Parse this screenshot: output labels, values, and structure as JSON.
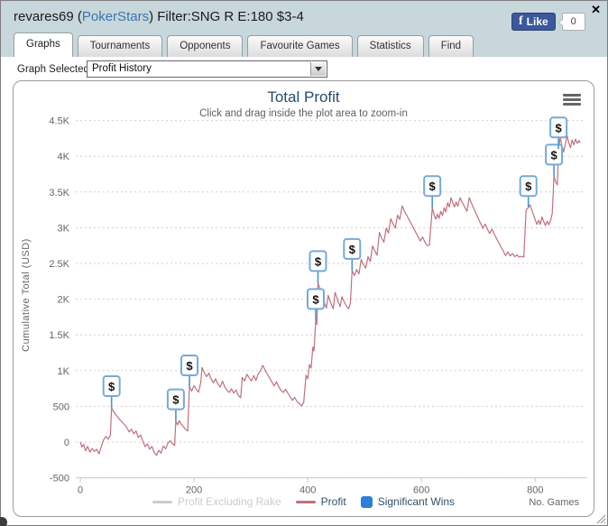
{
  "colors": {
    "header_bg": "#c7d7db",
    "fb_blue": "#3b579d",
    "link_blue": "#3a75b0",
    "title_navy": "#274b6d",
    "line_red": "#c0707a",
    "marker_blue": "#74aadb"
  },
  "header": {
    "title_prefix": "revares69 (",
    "site_link": "PokerStars",
    "title_suffix": ") Filter:SNG R E:180 $3-4",
    "fb_like_label": "Like",
    "fb_icon": "f",
    "fb_count": "0",
    "close_label": "✕"
  },
  "tabs": [
    {
      "label": "Graphs",
      "active": true
    },
    {
      "label": "Tournaments",
      "active": false
    },
    {
      "label": "Opponents",
      "active": false
    },
    {
      "label": "Favourite Games",
      "active": false
    },
    {
      "label": "Statistics",
      "active": false
    },
    {
      "label": "Find",
      "active": false
    }
  ],
  "graph_selector": {
    "label": "Graph Selected:",
    "value": "Profit History"
  },
  "chart_data": {
    "type": "line",
    "title": "Total Profit",
    "subtitle": "Click and drag inside the plot area to zoom-in",
    "ylabel": "Cumulative Total (USD)",
    "xlabel": "No. Games",
    "xlim": [
      0,
      890
    ],
    "ylim": [
      -500,
      4500
    ],
    "grid": "horizontal dotted",
    "legend_position": "bottom center",
    "xticks": [
      {
        "v": 0,
        "label": "0"
      },
      {
        "v": 200,
        "label": "200"
      },
      {
        "v": 400,
        "label": "400"
      },
      {
        "v": 600,
        "label": "600"
      },
      {
        "v": 800,
        "label": "800"
      }
    ],
    "yticks": [
      {
        "v": -500,
        "label": "-500"
      },
      {
        "v": 0,
        "label": "0"
      },
      {
        "v": 500,
        "label": "500"
      },
      {
        "v": 1000,
        "label": "1K"
      },
      {
        "v": 1500,
        "label": "1.5K"
      },
      {
        "v": 2000,
        "label": "2K"
      },
      {
        "v": 2500,
        "label": "2.5K"
      },
      {
        "v": 3000,
        "label": "3K"
      },
      {
        "v": 3500,
        "label": "3.5K"
      },
      {
        "v": 4000,
        "label": "4K"
      },
      {
        "v": 4500,
        "label": "4.5K"
      }
    ],
    "legend": [
      {
        "name": "Profit Excluding Rake",
        "color": "#cccccc",
        "symbol": "line",
        "enabled": false
      },
      {
        "name": "Profit",
        "color": "#c0707a",
        "symbol": "line",
        "enabled": true
      },
      {
        "name": "Significant Wins",
        "color": "#2f7ed8",
        "symbol": "square",
        "enabled": true
      }
    ],
    "series": [
      {
        "name": "Profit",
        "color": "#c0707a",
        "points": [
          [
            0,
            0
          ],
          [
            3,
            -70
          ],
          [
            6,
            -30
          ],
          [
            9,
            -120
          ],
          [
            13,
            -60
          ],
          [
            17,
            -140
          ],
          [
            21,
            -90
          ],
          [
            25,
            -130
          ],
          [
            29,
            -100
          ],
          [
            33,
            -165
          ],
          [
            37,
            -60
          ],
          [
            41,
            30
          ],
          [
            45,
            80
          ],
          [
            49,
            40
          ],
          [
            53,
            95
          ],
          [
            55,
            480
          ],
          [
            59,
            420
          ],
          [
            64,
            370
          ],
          [
            69,
            320
          ],
          [
            75,
            265
          ],
          [
            81,
            215
          ],
          [
            86,
            140
          ],
          [
            90,
            180
          ],
          [
            94,
            115
          ],
          [
            98,
            155
          ],
          [
            102,
            65
          ],
          [
            106,
            100
          ],
          [
            110,
            15
          ],
          [
            114,
            -65
          ],
          [
            118,
            -25
          ],
          [
            122,
            -100
          ],
          [
            126,
            -60
          ],
          [
            130,
            -145
          ],
          [
            134,
            -185
          ],
          [
            138,
            -115
          ],
          [
            142,
            -155
          ],
          [
            146,
            -55
          ],
          [
            150,
            -95
          ],
          [
            154,
            -15
          ],
          [
            158,
            20
          ],
          [
            162,
            -20
          ],
          [
            166,
            -45
          ],
          [
            168,
            295
          ],
          [
            171,
            240
          ],
          [
            174,
            300
          ],
          [
            177,
            255
          ],
          [
            181,
            220
          ],
          [
            185,
            180
          ],
          [
            189,
            155
          ],
          [
            192,
            770
          ],
          [
            196,
            715
          ],
          [
            200,
            790
          ],
          [
            204,
            740
          ],
          [
            208,
            700
          ],
          [
            212,
            835
          ],
          [
            214,
            1045
          ],
          [
            218,
            975
          ],
          [
            222,
            915
          ],
          [
            226,
            965
          ],
          [
            230,
            885
          ],
          [
            234,
            830
          ],
          [
            238,
            885
          ],
          [
            242,
            815
          ],
          [
            246,
            770
          ],
          [
            250,
            855
          ],
          [
            254,
            775
          ],
          [
            258,
            725
          ],
          [
            262,
            695
          ],
          [
            266,
            745
          ],
          [
            270,
            685
          ],
          [
            274,
            730
          ],
          [
            278,
            650
          ],
          [
            282,
            620
          ],
          [
            285,
            905
          ],
          [
            289,
            855
          ],
          [
            293,
            950
          ],
          [
            297,
            900
          ],
          [
            301,
            855
          ],
          [
            305,
            930
          ],
          [
            309,
            865
          ],
          [
            313,
            955
          ],
          [
            317,
            1000
          ],
          [
            321,
            1075
          ],
          [
            325,
            1005
          ],
          [
            329,
            950
          ],
          [
            333,
            895
          ],
          [
            337,
            840
          ],
          [
            341,
            785
          ],
          [
            345,
            845
          ],
          [
            349,
            775
          ],
          [
            353,
            725
          ],
          [
            357,
            695
          ],
          [
            361,
            740
          ],
          [
            365,
            685
          ],
          [
            369,
            635
          ],
          [
            373,
            585
          ],
          [
            377,
            625
          ],
          [
            381,
            570
          ],
          [
            385,
            540
          ],
          [
            389,
            505
          ],
          [
            393,
            555
          ],
          [
            397,
            935
          ],
          [
            400,
            885
          ],
          [
            403,
            1085
          ],
          [
            406,
            1035
          ],
          [
            409,
            1330
          ],
          [
            411,
            1275
          ],
          [
            414,
            1700
          ],
          [
            416,
            1645
          ],
          [
            418,
            2230
          ],
          [
            421,
            2155
          ],
          [
            424,
            2075
          ],
          [
            427,
            1995
          ],
          [
            430,
            1935
          ],
          [
            433,
            1875
          ],
          [
            436,
            2055
          ],
          [
            439,
            1985
          ],
          [
            442,
            1915
          ],
          [
            445,
            1865
          ],
          [
            448,
            2095
          ],
          [
            451,
            2025
          ],
          [
            454,
            1955
          ],
          [
            457,
            1895
          ],
          [
            460,
            2035
          ],
          [
            464,
            1965
          ],
          [
            468,
            1905
          ],
          [
            472,
            1865
          ],
          [
            475,
            1945
          ],
          [
            478,
            2400
          ],
          [
            482,
            2330
          ],
          [
            486,
            2415
          ],
          [
            490,
            2355
          ],
          [
            494,
            2555
          ],
          [
            498,
            2485
          ],
          [
            502,
            2435
          ],
          [
            506,
            2595
          ],
          [
            510,
            2525
          ],
          [
            514,
            2745
          ],
          [
            518,
            2675
          ],
          [
            522,
            2615
          ],
          [
            526,
            2935
          ],
          [
            530,
            2855
          ],
          [
            534,
            2795
          ],
          [
            538,
            2995
          ],
          [
            542,
            2925
          ],
          [
            546,
            3125
          ],
          [
            550,
            3055
          ],
          [
            554,
            2995
          ],
          [
            558,
            3175
          ],
          [
            562,
            3115
          ],
          [
            566,
            3305
          ],
          [
            570,
            3235
          ],
          [
            574,
            3175
          ],
          [
            578,
            3115
          ],
          [
            582,
            3055
          ],
          [
            586,
            2995
          ],
          [
            590,
            2935
          ],
          [
            594,
            2875
          ],
          [
            598,
            2815
          ],
          [
            602,
            2870
          ],
          [
            606,
            2800
          ],
          [
            610,
            2750
          ],
          [
            614,
            2755
          ],
          [
            619,
            3280
          ],
          [
            622,
            3180
          ],
          [
            625,
            3120
          ],
          [
            628,
            3190
          ],
          [
            631,
            3130
          ],
          [
            634,
            3230
          ],
          [
            637,
            3170
          ],
          [
            640,
            3280
          ],
          [
            643,
            3220
          ],
          [
            646,
            3350
          ],
          [
            649,
            3290
          ],
          [
            652,
            3420
          ],
          [
            655,
            3350
          ],
          [
            658,
            3290
          ],
          [
            661,
            3360
          ],
          [
            664,
            3300
          ],
          [
            668,
            3420
          ],
          [
            672,
            3350
          ],
          [
            676,
            3290
          ],
          [
            680,
            3230
          ],
          [
            684,
            3420
          ],
          [
            688,
            3340
          ],
          [
            692,
            3270
          ],
          [
            696,
            3200
          ],
          [
            700,
            3130
          ],
          [
            704,
            3060
          ],
          [
            708,
            2990
          ],
          [
            712,
            3050
          ],
          [
            716,
            2980
          ],
          [
            720,
            2920
          ],
          [
            724,
            2980
          ],
          [
            728,
            2910
          ],
          [
            732,
            2850
          ],
          [
            736,
            2790
          ],
          [
            740,
            2730
          ],
          [
            744,
            2670
          ],
          [
            748,
            2610
          ],
          [
            752,
            2660
          ],
          [
            756,
            2605
          ],
          [
            760,
            2640
          ],
          [
            764,
            2595
          ],
          [
            768,
            2620
          ],
          [
            772,
            2590
          ],
          [
            776,
            2600
          ],
          [
            780,
            2590
          ],
          [
            784,
            3250
          ],
          [
            788,
            3280
          ],
          [
            791,
            3320
          ],
          [
            794,
            3250
          ],
          [
            797,
            3180
          ],
          [
            800,
            3110
          ],
          [
            803,
            3045
          ],
          [
            806,
            3105
          ],
          [
            809,
            3045
          ],
          [
            812,
            3150
          ],
          [
            815,
            3090
          ],
          [
            818,
            3030
          ],
          [
            821,
            3090
          ],
          [
            824,
            3040
          ],
          [
            827,
            3100
          ],
          [
            830,
            3200
          ],
          [
            833,
            3720
          ],
          [
            836,
            3640
          ],
          [
            839,
            3600
          ],
          [
            841,
            4100
          ],
          [
            844,
            4260
          ],
          [
            847,
            4150
          ],
          [
            850,
            4060
          ],
          [
            853,
            4170
          ],
          [
            856,
            4290
          ],
          [
            859,
            4190
          ],
          [
            862,
            4120
          ],
          [
            865,
            4230
          ],
          [
            868,
            4160
          ],
          [
            871,
            4240
          ],
          [
            874,
            4180
          ],
          [
            877,
            4220
          ],
          [
            879,
            4190
          ]
        ]
      }
    ],
    "significant_wins": {
      "marker_label": "$",
      "marker_border": "#74aadb",
      "stem_color": "#4f93d2",
      "points": [
        [
          55,
          480
        ],
        [
          168,
          295
        ],
        [
          192,
          770
        ],
        [
          414,
          1700
        ],
        [
          418,
          2230
        ],
        [
          478,
          2400
        ],
        [
          619,
          3280
        ],
        [
          788,
          3280
        ],
        [
          833,
          3720
        ],
        [
          841,
          4100
        ]
      ]
    }
  }
}
